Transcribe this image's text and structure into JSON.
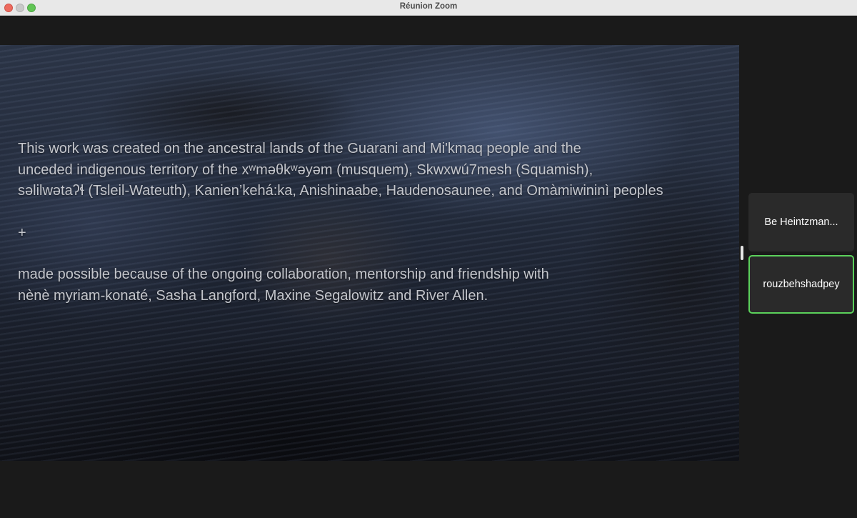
{
  "window": {
    "title": "Réunion Zoom"
  },
  "slide": {
    "lines": [
      "This work was created on the ancestral lands of the Guarani and Mi'kmaq people and the",
      "unceded indigenous territory of the xʷməθkʷəyəm (musquem), Skwxwú7mesh (Squamish),",
      "səlilwətaʔɬ (Tsleil-Wateuth), Kanien’kehá:ka, Anishinaabe, Haudenosaunee, and Omàmiwininì peoples"
    ],
    "plus": "+",
    "lines2": [
      "made possible because of the ongoing collaboration, mentorship and friendship with",
      "nènè myriam-konaté, Sasha Langford, Maxine Segalowitz and River Allen."
    ]
  },
  "participants": [
    {
      "name": "Be Heintzman..."
    },
    {
      "name": "rouzbehshadpey",
      "active_speaker": true
    }
  ],
  "colors": {
    "active_speaker_border": "#5bd15b",
    "tile_background": "#2a2a2a",
    "window_background": "#1a1a1a"
  }
}
